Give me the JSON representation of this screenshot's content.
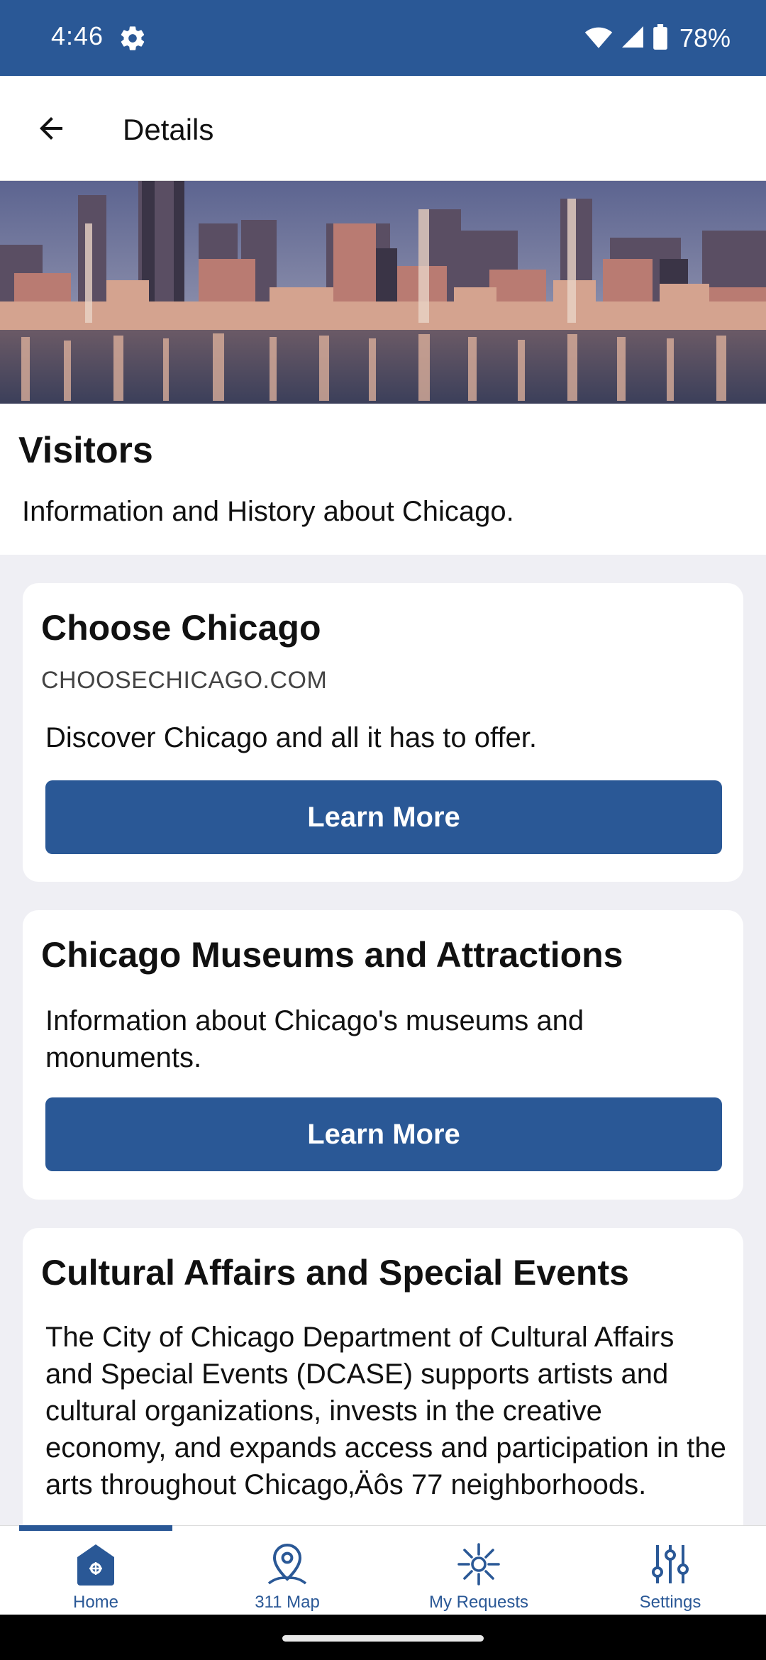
{
  "status_bar": {
    "time": "4:46",
    "battery": "78%",
    "icons": [
      "settings-gear-icon",
      "wifi-icon",
      "signal-icon",
      "battery-icon"
    ]
  },
  "app_bar": {
    "title": "Details",
    "back_icon": "arrow-left-icon"
  },
  "intro": {
    "title": "Visitors",
    "description": "Information and History about Chicago."
  },
  "cards": [
    {
      "title": "Choose Chicago",
      "subtitle": "CHOOSECHICAGO.COM",
      "description": "Discover Chicago and all it has to offer.",
      "button_label": "Learn More"
    },
    {
      "title": "Chicago Museums and Attractions",
      "description": "Information about Chicago's museums and monuments.",
      "button_label": "Learn More"
    },
    {
      "title": "Cultural Affairs and Special Events",
      "description": "The City of Chicago Department of Cultural Affairs and Special Events (DCASE) supports artists and cultural organizations, invests in the creative economy, and expands access and participation in the arts throughout Chicago‚Äôs 77 neighborhoods."
    }
  ],
  "bottom_nav": {
    "items": [
      {
        "label": "Home",
        "icon": "home-icon",
        "active": true
      },
      {
        "label": "311 Map",
        "icon": "map-pin-icon",
        "active": false
      },
      {
        "label": "My Requests",
        "icon": "requests-burst-icon",
        "active": false
      },
      {
        "label": "Settings",
        "icon": "sliders-icon",
        "active": false
      }
    ]
  },
  "colors": {
    "primary": "#2a5896",
    "background": "#efeff4",
    "card": "#ffffff"
  }
}
